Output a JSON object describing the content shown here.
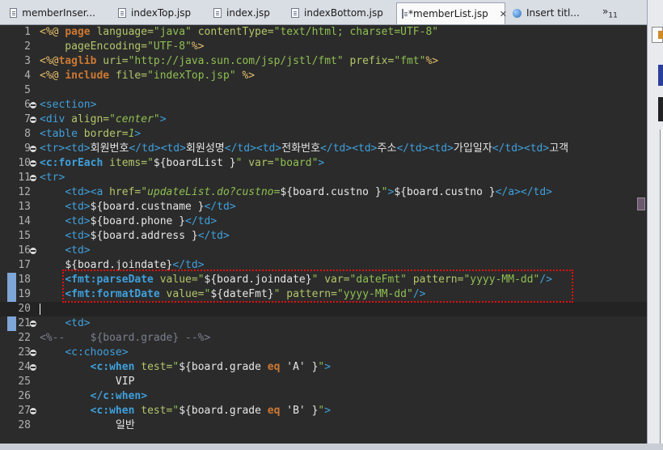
{
  "tabs": [
    {
      "label": "memberInser...",
      "icon": "jsp-file-icon",
      "active": false
    },
    {
      "label": "indexTop.jsp",
      "icon": "jsp-file-icon",
      "active": false
    },
    {
      "label": "index.jsp",
      "icon": "jsp-file-icon",
      "active": false
    },
    {
      "label": "indexBottom.jsp",
      "icon": "jsp-file-icon",
      "active": false
    },
    {
      "label": "*memberList.jsp",
      "icon": "jsp-file-icon",
      "active": true,
      "close": "✕"
    },
    {
      "label": "Insert titl...",
      "icon": "globe-icon",
      "active": false
    }
  ],
  "overflow": {
    "label": "»",
    "count": "11"
  },
  "lines": [
    {
      "n": "1",
      "fold": false
    },
    {
      "n": "2",
      "fold": false
    },
    {
      "n": "3",
      "fold": false
    },
    {
      "n": "4",
      "fold": false
    },
    {
      "n": "5",
      "fold": false
    },
    {
      "n": "6",
      "fold": true
    },
    {
      "n": "7",
      "fold": true
    },
    {
      "n": "8",
      "fold": false
    },
    {
      "n": "9",
      "fold": true
    },
    {
      "n": "10",
      "fold": true
    },
    {
      "n": "11",
      "fold": true
    },
    {
      "n": "12",
      "fold": false
    },
    {
      "n": "13",
      "fold": false
    },
    {
      "n": "14",
      "fold": false
    },
    {
      "n": "15",
      "fold": false
    },
    {
      "n": "16",
      "fold": true
    },
    {
      "n": "17",
      "fold": false
    },
    {
      "n": "18",
      "fold": false
    },
    {
      "n": "19",
      "fold": false
    },
    {
      "n": "20",
      "fold": false
    },
    {
      "n": "21",
      "fold": true
    },
    {
      "n": "22",
      "fold": false
    },
    {
      "n": "23",
      "fold": true
    },
    {
      "n": "24",
      "fold": true
    },
    {
      "n": "25",
      "fold": false
    },
    {
      "n": "26",
      "fold": false
    },
    {
      "n": "27",
      "fold": true
    },
    {
      "n": "28",
      "fold": false
    }
  ],
  "code": {
    "l1": [
      "<%@ ",
      "page ",
      "language=",
      "\"java\" ",
      "contentType=",
      "\"text/html; charset=UTF-8\""
    ],
    "l2": [
      "    pageEncoding=",
      "\"UTF-8\"",
      "%>"
    ],
    "l3": [
      "<%@",
      "taglib ",
      "uri=",
      "\"http://java.sun.com/jsp/jstl/fmt\" ",
      "prefix=",
      "\"fmt\"",
      "%>"
    ],
    "l4": [
      "<%@ ",
      "include ",
      "file=",
      "\"indexTop.jsp\" ",
      "%>"
    ],
    "l6": [
      "<section>"
    ],
    "l7": [
      "<div ",
      "align=",
      "\"center\"",
      ">"
    ],
    "l8": [
      "<table ",
      "border=",
      "1",
      ">"
    ],
    "l9": [
      "<tr>",
      "<td>",
      "회원번호",
      "</td>",
      "<td>",
      "회원성명",
      "</td>",
      "<td>",
      "전화번호",
      "</td>",
      "<td>",
      "주소",
      "</td>",
      "<td>",
      "가입일자",
      "</td>",
      "<td>",
      "고객"
    ],
    "l10": [
      "<c:forEach ",
      "items=",
      "\"",
      "${boardList }",
      "\" ",
      "var=",
      "\"board\"",
      ">"
    ],
    "l11": [
      "<tr>"
    ],
    "l12": [
      "    ",
      "<td>",
      "<a ",
      "href=",
      "\"updateList.do?custno=",
      "${board.custno }",
      "\"",
      ">",
      "${board.custno }",
      "</a>",
      "</td>"
    ],
    "l13": [
      "    ",
      "<td>",
      "${board.custname }",
      "</td>"
    ],
    "l14": [
      "    ",
      "<td>",
      "${board.phone }",
      "</td>"
    ],
    "l15": [
      "    ",
      "<td>",
      "${board.address }",
      "</td>"
    ],
    "l16": [
      "    ",
      "<td>"
    ],
    "l17": [
      "    ",
      "${board.joindate}",
      "</td>"
    ],
    "l18": [
      "    ",
      "<fmt:parseDate ",
      "value=",
      "\"",
      "${board.joindate}",
      "\" ",
      "var=",
      "\"dateFmt\" ",
      "pattern=",
      "\"yyyy-MM-dd\"",
      "/>"
    ],
    "l19": [
      "    ",
      "<fmt:formatDate ",
      "value=",
      "\"",
      "${dateFmt}",
      "\" ",
      "pattern=",
      "\"yyyy-MM-dd\"",
      "/>"
    ],
    "l21": [
      "    ",
      "<td>"
    ],
    "l22": [
      "<%--    ${board.grade} --%>"
    ],
    "l23": [
      "    ",
      "<c:choose>"
    ],
    "l24": [
      "        ",
      "<c:when ",
      "test=",
      "\"",
      "${board.grade ",
      "eq ",
      "'A' }",
      "\"",
      ">"
    ],
    "l25": [
      "            VIP"
    ],
    "l26": [
      "        ",
      "</c:when>"
    ],
    "l27": [
      "        ",
      "<c:when ",
      "test=",
      "\"",
      "${board.grade ",
      "eq ",
      "'B' }",
      "\"",
      ">"
    ],
    "l28": [
      "            일반"
    ]
  }
}
